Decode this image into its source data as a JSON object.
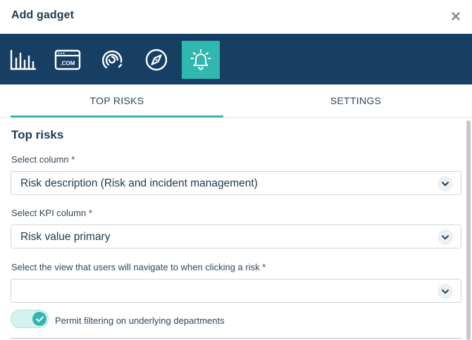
{
  "dialog": {
    "title": "Add gadget",
    "close_symbol": "×"
  },
  "toolbar": {
    "gadgets": [
      {
        "icon": "bar-chart-icon",
        "active": false
      },
      {
        "icon": "dot-com-icon",
        "label": ".COM",
        "active": false
      },
      {
        "icon": "gauge-icon",
        "active": false
      },
      {
        "icon": "compass-icon",
        "active": false
      },
      {
        "icon": "bell-alert-icon",
        "active": true
      }
    ],
    "active_color": "#2fb7b0",
    "background_color": "#173f63"
  },
  "tabs": [
    {
      "label": "TOP RISKS",
      "active": true
    },
    {
      "label": "SETTINGS",
      "active": false
    }
  ],
  "form": {
    "section_title": "Top risks",
    "column": {
      "label": "Select column *",
      "value": "Risk description (Risk and incident management)"
    },
    "kpi_column": {
      "label": "Select KPI column *",
      "value": "Risk value primary"
    },
    "navigate_view": {
      "label": "Select the view that users will navigate to when clicking a risk *",
      "value": ""
    },
    "permit_filtering": {
      "label": "Permit filtering on underlying departments",
      "checked": true
    }
  }
}
